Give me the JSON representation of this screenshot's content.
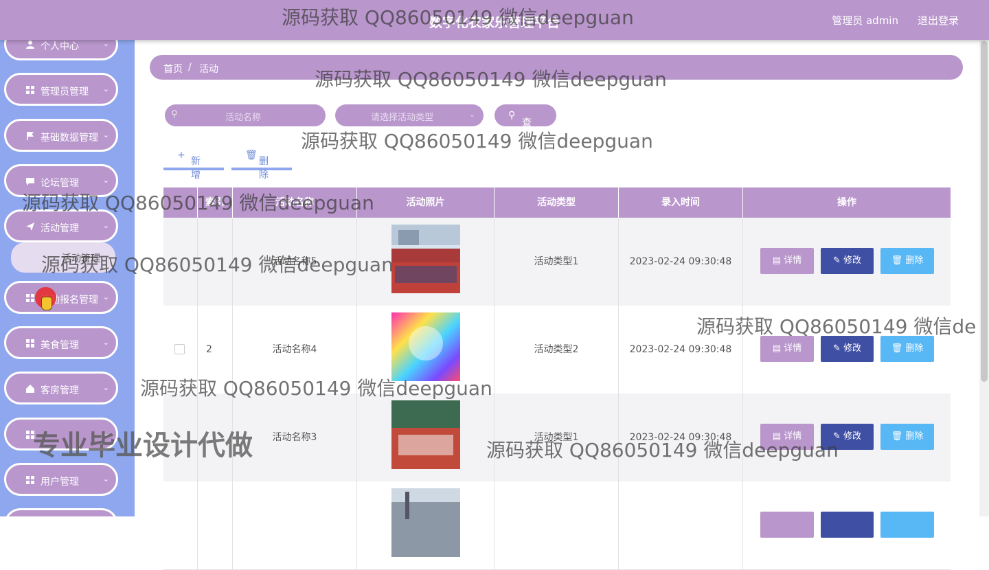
{
  "header": {
    "title": "数字化农家乐管理平台",
    "admin": "管理员 admin",
    "logout": "退出登录",
    "color": "#b996cc"
  },
  "sidebar": {
    "items": [
      {
        "label": "个人中心",
        "icon": "user-icon"
      },
      {
        "label": "管理员管理",
        "icon": "grid-icon"
      },
      {
        "label": "基础数据管理",
        "icon": "flag-icon"
      },
      {
        "label": "论坛管理",
        "icon": "chat-icon"
      },
      {
        "label": "活动管理",
        "icon": "send-icon"
      },
      {
        "label": "活动报名管理",
        "icon": "grid-icon"
      },
      {
        "label": "美食管理",
        "icon": "grid-icon"
      },
      {
        "label": "客房管理",
        "icon": "home-icon"
      },
      {
        "label": "",
        "icon": "grid-icon"
      },
      {
        "label": "用户管理",
        "icon": "grid-icon"
      }
    ],
    "sub_item": "活动管理",
    "color": "#8ea7ee"
  },
  "breadcrumb": {
    "home": "首页",
    "sep": "/",
    "current": "活动"
  },
  "search": {
    "name_placeholder": "活动名称",
    "type_placeholder": "请选择活动类型",
    "button": "查询"
  },
  "toolbar": {
    "add": "新增",
    "delete": "删除"
  },
  "table": {
    "headers": [
      "",
      "索引",
      "活动名称",
      "活动照片",
      "活动类型",
      "录入时间",
      "操作"
    ],
    "rows": [
      {
        "index": "",
        "name": "活动名称5",
        "type": "活动类型1",
        "time": "2023-02-24 09:30:48"
      },
      {
        "index": "2",
        "name": "活动名称4",
        "type": "活动类型2",
        "time": "2023-02-24 09:30:48"
      },
      {
        "index": "",
        "name": "活动名称3",
        "type": "活动类型1",
        "time": "2023-02-24 09:30:48"
      },
      {
        "index": "",
        "name": "",
        "type": "",
        "time": ""
      }
    ],
    "actions": {
      "detail": "详情",
      "edit": "修改",
      "delete": "删除"
    }
  },
  "watermarks": {
    "text": "源码获取 QQ86050149 微信deepguan",
    "partial": "源码获取 QQ86050149 微信de",
    "big": "专业毕业设计代做"
  }
}
